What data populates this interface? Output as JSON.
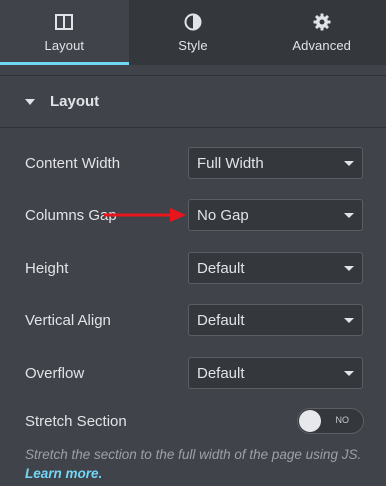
{
  "tabs": [
    {
      "label": "Layout",
      "icon": "columns-icon",
      "active": true
    },
    {
      "label": "Style",
      "icon": "half-circle-icon",
      "active": false
    },
    {
      "label": "Advanced",
      "icon": "gear-icon",
      "active": false
    }
  ],
  "section": {
    "title": "Layout"
  },
  "controls": {
    "content_width": {
      "label": "Content Width",
      "value": "Full Width"
    },
    "columns_gap": {
      "label": "Columns Gap",
      "value": "No Gap"
    },
    "height": {
      "label": "Height",
      "value": "Default"
    },
    "vertical_align": {
      "label": "Vertical Align",
      "value": "Default"
    },
    "overflow": {
      "label": "Overflow",
      "value": "Default"
    },
    "stretch_section": {
      "label": "Stretch Section",
      "switch_text": "NO"
    }
  },
  "description": {
    "text": "Stretch the section to the full width of the page using JS.",
    "link_text": "Learn more."
  },
  "colors": {
    "accent": "#71d7f7",
    "panel": "#404349",
    "tabbar": "#34383c",
    "annotation": "#e8161c"
  }
}
